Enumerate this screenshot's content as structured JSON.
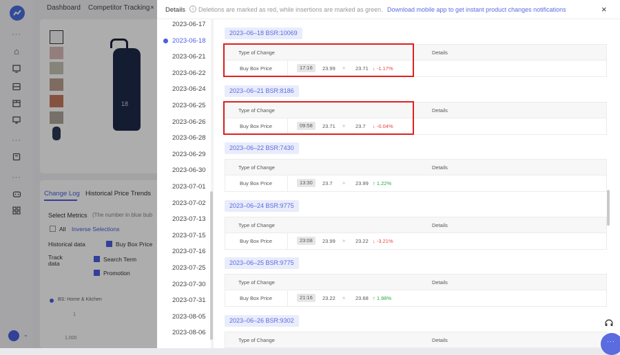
{
  "rail": {
    "icons": [
      "logo-icon",
      "home-icon",
      "monitor-icon",
      "inbox-icon",
      "box-icon",
      "screen-icon",
      "store-icon",
      "robot-icon",
      "apps-icon",
      "user-icon"
    ]
  },
  "topnav": {
    "tab1": "Dashboard",
    "tab2": "Competitor Tracking",
    "close": "×"
  },
  "background": {
    "tabs": [
      "Change Log",
      "Historical Price Trends"
    ],
    "select_metrics": "Select Metrics",
    "select_hint": "(The number in blue bub",
    "all": "All",
    "inverse": "Inverse Selections",
    "historical_data": "Historical data",
    "buy_box": "Buy Box Price",
    "track_data": "Track data",
    "search_term": "Search Term",
    "promotion": "Promotion",
    "legend": "BS: Home & Kitchen",
    "axis1": "1",
    "axis2": "1,000",
    "bottle_label": "18"
  },
  "drawer": {
    "title": "Details",
    "notice": "Deletions are marked as red, while insertions are marked as green.",
    "link": "Download mobile app to get instant product changes notifications",
    "close": "×"
  },
  "dates": [
    "2023-06-17",
    "2023-06-18",
    "2023-06-21",
    "2023-06-22",
    "2023-06-24",
    "2023-06-25",
    "2023-06-26",
    "2023-06-28",
    "2023-06-29",
    "2023-06-30",
    "2023-07-01",
    "2023-07-02",
    "2023-07-13",
    "2023-07-15",
    "2023-07-16",
    "2023-07-25",
    "2023-07-30",
    "2023-07-31",
    "2023-08-05",
    "2023-08-06"
  ],
  "active_date": "2023-06-18",
  "table_headers": {
    "type": "Type of Change",
    "details": "Details"
  },
  "entries": [
    {
      "tag": "2023–06–18 BSR:10069",
      "type": "Buy Box Price",
      "time": "17:16",
      "from": "23.99",
      "arrow": "»",
      "to": "23.71",
      "change": "-1.17%",
      "direction": "down",
      "arrow_icon": "↓",
      "highlighted": true
    },
    {
      "tag": "2023–06–21 BSR:8186",
      "type": "Buy Box Price",
      "time": "09:58",
      "from": "23.71",
      "arrow": "»",
      "to": "23.7",
      "change": "-0.04%",
      "direction": "down",
      "arrow_icon": "↓",
      "highlighted": true
    },
    {
      "tag": "2023–06–22 BSR:7430",
      "type": "Buy Box Price",
      "time": "13:30",
      "from": "23.7",
      "arrow": "»",
      "to": "23.99",
      "change": "1.22%",
      "direction": "up",
      "arrow_icon": "↑",
      "highlighted": false
    },
    {
      "tag": "2023–06–24 BSR:9775",
      "type": "Buy Box Price",
      "time": "23:08",
      "from": "23.99",
      "arrow": "»",
      "to": "23.22",
      "change": "-3.21%",
      "direction": "down",
      "arrow_icon": "↓",
      "highlighted": false
    },
    {
      "tag": "2023–06–25 BSR:9775",
      "type": "Buy Box Price",
      "time": "21:16",
      "from": "23.22",
      "arrow": "»",
      "to": "23.68",
      "change": "1.98%",
      "direction": "up",
      "arrow_icon": "↑",
      "highlighted": false
    },
    {
      "tag": "2023–06–26 BSR:9302",
      "type": "",
      "time": "",
      "from": "",
      "arrow": "",
      "to": "",
      "change": "",
      "direction": "",
      "arrow_icon": "",
      "highlighted": false
    }
  ],
  "colors": {
    "accent": "#4b5fe0",
    "down": "#e54545",
    "up": "#28a745",
    "highlight": "#e01f1f"
  }
}
